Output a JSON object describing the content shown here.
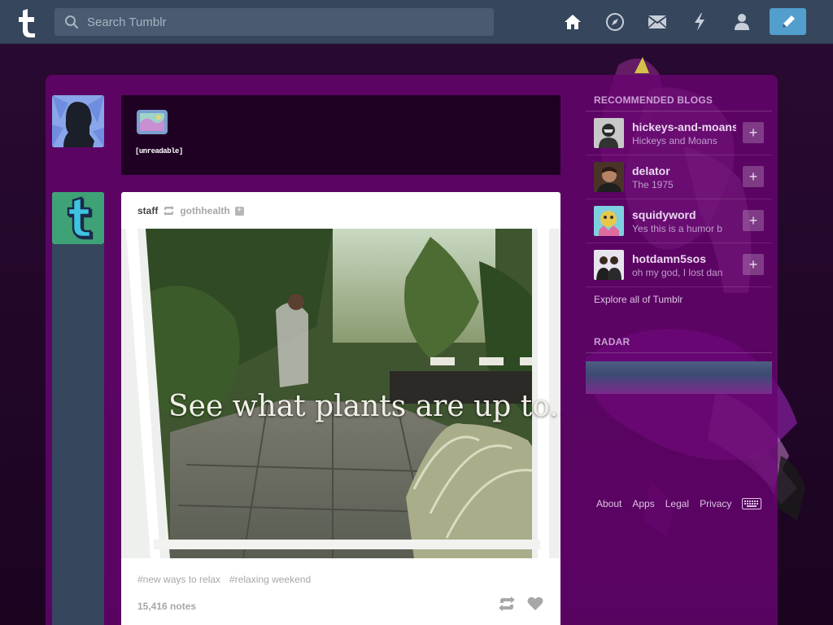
{
  "navbar": {
    "search_placeholder": "Search Tumblr",
    "icons": [
      "home-icon",
      "explore-compass-icon",
      "inbox-mail-icon",
      "activity-lightning-icon",
      "account-person-icon"
    ],
    "compose_icon": "pencil-icon"
  },
  "post_form": {
    "label": "[unreadable]"
  },
  "post": {
    "blog": "staff",
    "source": "gothhealth",
    "caption": "See what plants are up to...",
    "tags": [
      "#new ways to relax",
      "#relaxing weekend"
    ],
    "notes": "15,416 notes"
  },
  "sidebar": {
    "recommended_heading": "RECOMMENDED BLOGS",
    "blogs": [
      {
        "name": "hickeys-and-moans",
        "subtitle": "Hickeys and Moans"
      },
      {
        "name": "delator",
        "subtitle": "The 1975"
      },
      {
        "name": "squidyword",
        "subtitle": "Yes this is a humor b"
      },
      {
        "name": "hotdamn5sos",
        "subtitle": "oh my god, I lost dan"
      }
    ],
    "explore_link": "Explore all of Tumblr",
    "radar_heading": "RADAR"
  },
  "footer": {
    "about": "About",
    "apps": "Apps",
    "legal": "Legal",
    "privacy": "Privacy",
    "keyboard_icon": "keyboard-icon"
  },
  "colors": {
    "navbar": "#36465d",
    "compose": "#529ecc",
    "panel": "#680470",
    "staff_avatar": "#3fa277"
  }
}
